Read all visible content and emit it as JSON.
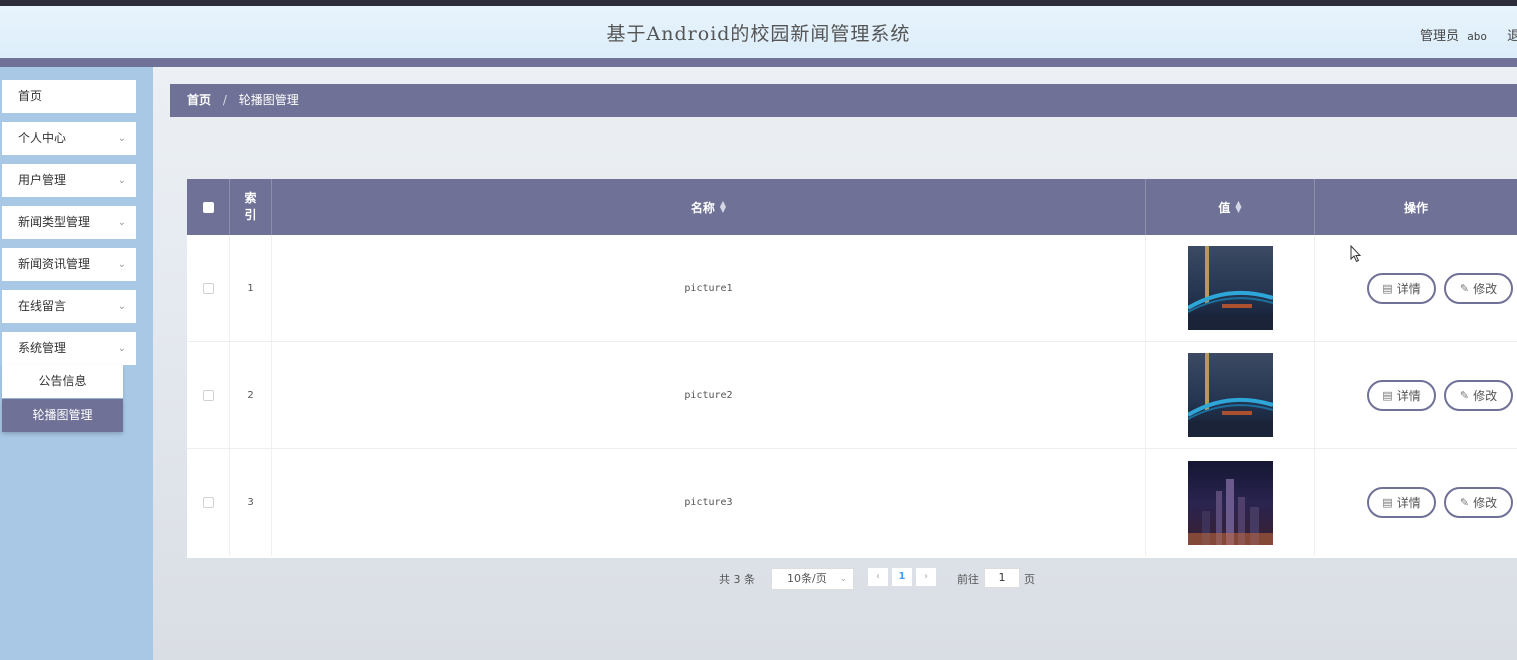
{
  "header": {
    "title": "基于Android的校园新闻管理系统",
    "user_label": "管理员",
    "username": "abo",
    "logout": "退"
  },
  "sidebar": {
    "items": [
      {
        "label": "首页",
        "has_chevron": false
      },
      {
        "label": "个人中心",
        "has_chevron": true
      },
      {
        "label": "用户管理",
        "has_chevron": true
      },
      {
        "label": "新闻类型管理",
        "has_chevron": true
      },
      {
        "label": "新闻资讯管理",
        "has_chevron": true
      },
      {
        "label": "在线留言",
        "has_chevron": true
      },
      {
        "label": "系统管理",
        "has_chevron": true
      }
    ],
    "submenu": [
      {
        "label": "公告信息",
        "active": false
      },
      {
        "label": "轮播图管理",
        "active": true
      }
    ]
  },
  "breadcrumb": {
    "home": "首页",
    "separator": "/",
    "current": "轮播图管理"
  },
  "table": {
    "headers": {
      "index": "索引",
      "name": "名称",
      "value": "值",
      "actions": "操作"
    },
    "rows": [
      {
        "index": "1",
        "name": "picture1",
        "image": "bridge-night"
      },
      {
        "index": "2",
        "name": "picture2",
        "image": "bridge-night"
      },
      {
        "index": "3",
        "name": "picture3",
        "image": "city-night"
      }
    ],
    "detail_label": "详情",
    "edit_label": "修改"
  },
  "pagination": {
    "total_prefix": "共",
    "total": "3",
    "total_suffix": "条",
    "page_size": "10条/页",
    "current_page": "1",
    "goto_label": "前往",
    "goto_value": "1",
    "page_suffix": "页"
  },
  "colors": {
    "accent": "#6f7196",
    "sidebar_bg": "#a8c8e6",
    "header_bg": "#e8f4fd"
  }
}
